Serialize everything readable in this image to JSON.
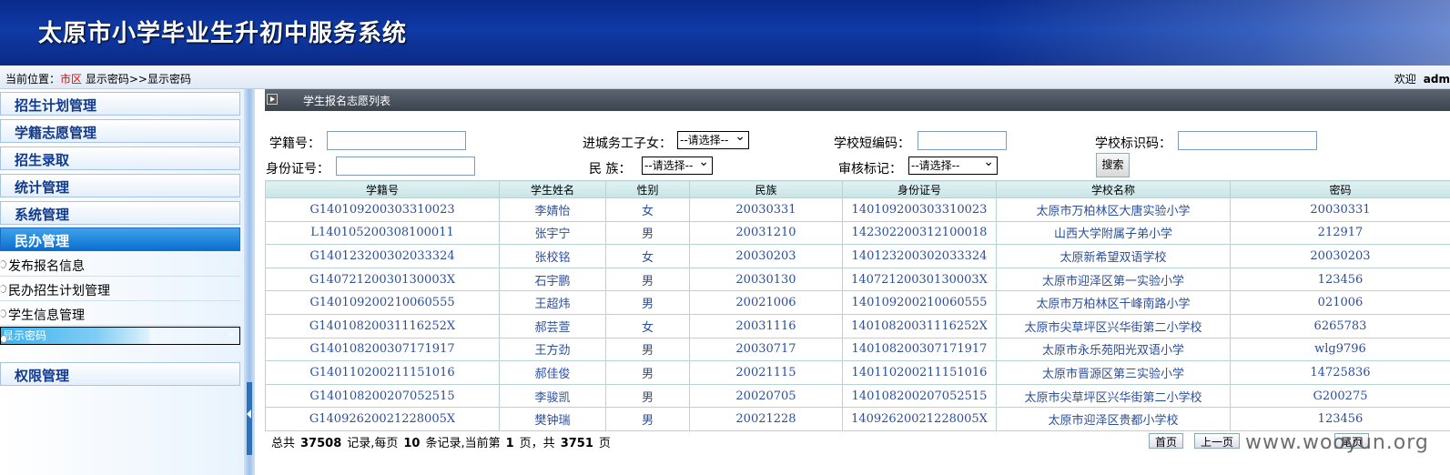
{
  "banner": {
    "title": "太原市小学毕业生升初中服务系统"
  },
  "location": {
    "prefix": "当前位置：",
    "area": "市区",
    "path": "显示密码>>显示密码",
    "welcome": "欢迎",
    "user": "adm"
  },
  "sidebar": {
    "menus": [
      "招生计划管理",
      "学籍志愿管理",
      "招生录取",
      "统计管理",
      "系统管理",
      "民办管理"
    ],
    "sub_items": [
      "发布报名信息",
      "民办招生计划管理",
      "学生信息管理",
      "显示密码"
    ],
    "bottom_menu": "权限管理"
  },
  "panel": {
    "title": "学生报名志愿列表"
  },
  "search": {
    "xueji_label": "学籍号：",
    "xueji_value": "",
    "jincheng_label": "进城务工子女：",
    "jincheng_value": "--请选择--",
    "school_short_label": "学校短编码：",
    "school_short_value": "",
    "school_id_label": "学校标识码：",
    "school_id_value": "",
    "idcard_label": "身份证号：",
    "idcard_value": "",
    "nation_label": "民  族：",
    "nation_value": "--请选择--",
    "audit_label": "审核标记：",
    "audit_value": "--请选择--",
    "search_button": "搜索"
  },
  "table": {
    "headers": [
      "学籍号",
      "学生姓名",
      "性别",
      "民族",
      "身份证号",
      "学校名称",
      "密码"
    ],
    "rows": [
      [
        "G140109200303310023",
        "李婧怡",
        "女",
        "20030331",
        "140109200303310023",
        "太原市万柏林区大唐实验小学",
        "20030331"
      ],
      [
        "L140105200308100011",
        "张宇宁",
        "男",
        "20031210",
        "142302200312100018",
        "山西大学附属子弟小学",
        "212917"
      ],
      [
        "G140123200302033324",
        "张校铭",
        "女",
        "20030203",
        "140123200302033324",
        "太原新希望双语学校",
        "20030203"
      ],
      [
        "G14072120030130003X",
        "石宇鹏",
        "男",
        "20030130",
        "14072120030130003X",
        "太原市迎泽区第一实验小学",
        "123456"
      ],
      [
        "G140109200210060555",
        "王超炜",
        "男",
        "20021006",
        "140109200210060555",
        "太原市万柏林区千峰南路小学",
        "021006"
      ],
      [
        "G14010820031116252X",
        "郝芸萱",
        "女",
        "20031116",
        "14010820031116252X",
        "太原市尖草坪区兴华街第二小学校",
        "6265783"
      ],
      [
        "G140108200307171917",
        "王方劲",
        "男",
        "20030717",
        "140108200307171917",
        "太原市永乐苑阳光双语小学",
        "wlg9796"
      ],
      [
        "G140110200211151016",
        "郝佳俊",
        "男",
        "20021115",
        "140110200211151016",
        "太原市晋源区第三实验小学",
        "14725836"
      ],
      [
        "G140108200207052515",
        "李骏凯",
        "男",
        "20020705",
        "140108200207052515",
        "太原市尖草坪区兴华街第二小学校",
        "G200275"
      ],
      [
        "G14092620021228005X",
        "樊钟瑞",
        "男",
        "20021228",
        "14092620021228005X",
        "太原市迎泽区贵都小学校",
        "123456"
      ]
    ]
  },
  "pagination": {
    "total_prefix": "总共",
    "total": "37508",
    "per_page_text": "记录,每页",
    "per_page": "10",
    "current_text": "条记录,当前第",
    "current": "1",
    "pages_text": "页，共",
    "pages": "3751",
    "suffix": "页",
    "first": "首页",
    "prev": "上一页",
    "last": "尾页"
  },
  "watermark": "www.wooyun.org"
}
